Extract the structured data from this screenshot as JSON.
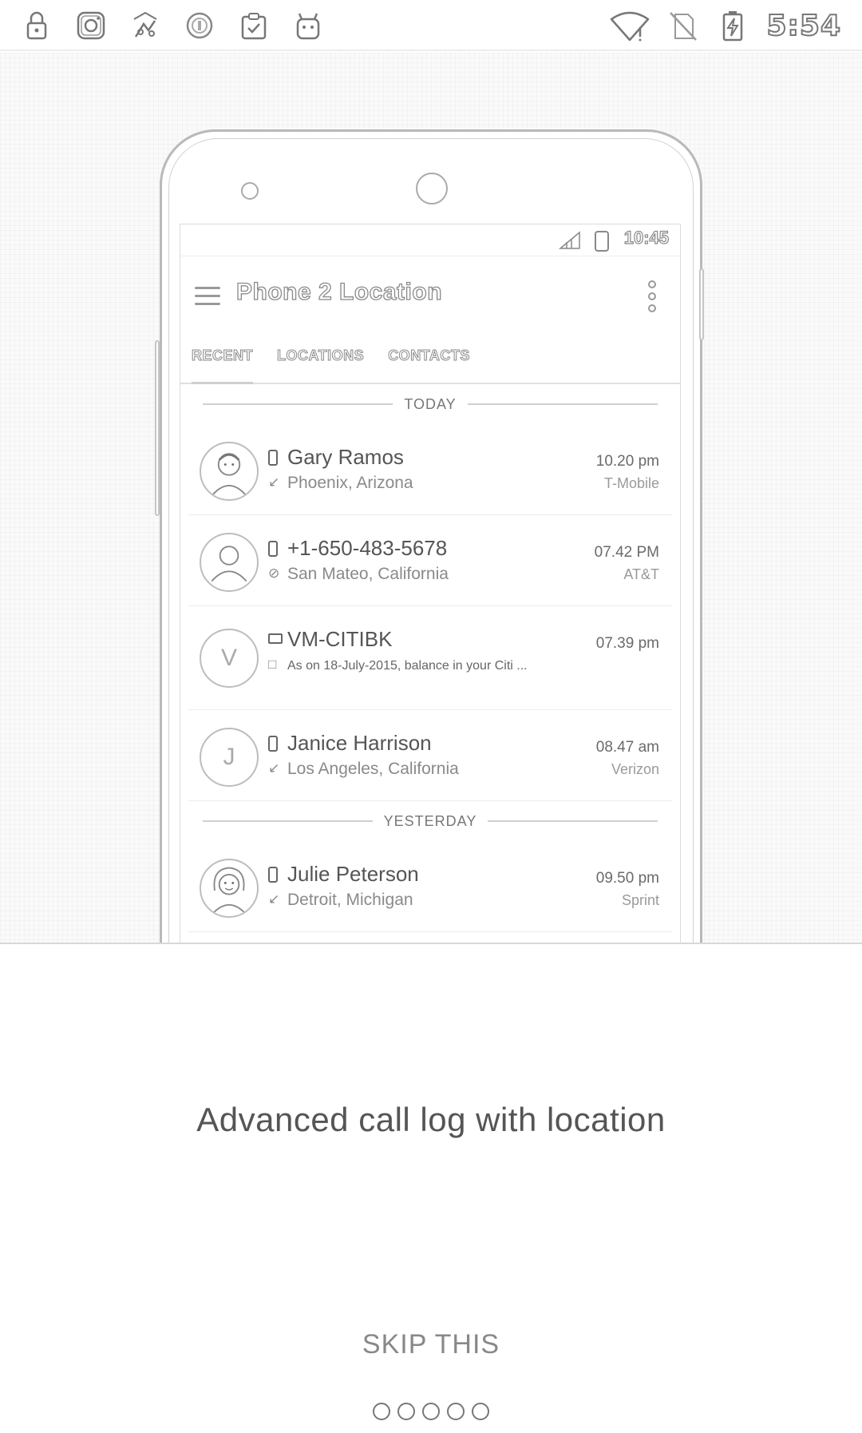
{
  "status_bar": {
    "time": "5:54",
    "left_icons": [
      "lock-icon",
      "instagram-icon",
      "fake-gps-icon",
      "circle-icon",
      "clipboard-check-icon",
      "android-icon"
    ],
    "right_icons": [
      "wifi-icon",
      "no-sim-icon",
      "battery-charging-icon"
    ]
  },
  "mock_phone": {
    "status_time": "10:45",
    "app_title": "Phone 2 Location",
    "tabs": [
      {
        "label": "RECENT",
        "active": true
      },
      {
        "label": "LOCATIONS",
        "active": false
      },
      {
        "label": "CONTACTS",
        "active": false
      }
    ],
    "sections": {
      "today": "TODAY",
      "yesterday": "YESTERDAY"
    },
    "calls": [
      {
        "name": "Gary Ramos",
        "location": "Phoenix, Arizona",
        "time": "10.20 pm",
        "carrier": "T-Mobile",
        "avatar": "photo"
      },
      {
        "name": "+1-650-483-5678",
        "location": "San Mateo, California",
        "time": "07.42 PM",
        "carrier": "AT&T",
        "avatar": "person"
      },
      {
        "name": "VM-CITIBK",
        "location": "As on 18-July-2015, balance in your Citi ...",
        "time": "07.39 pm",
        "carrier": "",
        "avatar": "V"
      },
      {
        "name": "Janice Harrison",
        "location": "Los Angeles, California",
        "time": "08.47 am",
        "carrier": "Verizon",
        "avatar": "J"
      },
      {
        "name": "Julie Peterson",
        "location": "Detroit, Michigan",
        "time": "09.50 pm",
        "carrier": "Sprint",
        "avatar": "photo"
      }
    ]
  },
  "onboarding": {
    "headline": "Advanced call log with location",
    "skip_label": "SKIP THIS",
    "page_count": 5,
    "current_page": 1
  }
}
